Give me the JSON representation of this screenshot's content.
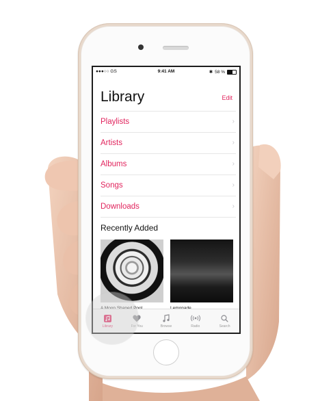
{
  "status_bar": {
    "carrier": "●●●○○ GS",
    "time": "9:41 AM",
    "battery_percent": "58 %"
  },
  "header": {
    "title": "Library",
    "edit_label": "Edit"
  },
  "menu": {
    "items": [
      {
        "label": "Playlists"
      },
      {
        "label": "Artists"
      },
      {
        "label": "Albums"
      },
      {
        "label": "Songs"
      },
      {
        "label": "Downloads"
      }
    ]
  },
  "recently_added": {
    "title": "Recently Added",
    "albums": [
      {
        "title": "A Moon Shaped Pool"
      },
      {
        "title": "Lemonade"
      }
    ]
  },
  "tab_bar": {
    "tabs": [
      {
        "label": "Library",
        "icon": "music-note-square-icon",
        "active": true
      },
      {
        "label": "For You",
        "icon": "heart-icon",
        "active": false
      },
      {
        "label": "Browse",
        "icon": "music-note-icon",
        "active": false
      },
      {
        "label": "Radio",
        "icon": "radio-waves-icon",
        "active": false
      },
      {
        "label": "Search",
        "icon": "search-icon",
        "active": false
      }
    ]
  },
  "colors": {
    "accent": "#e1245d",
    "phone_body": "#e8d9cc",
    "tab_inactive": "#9a9a9a"
  }
}
